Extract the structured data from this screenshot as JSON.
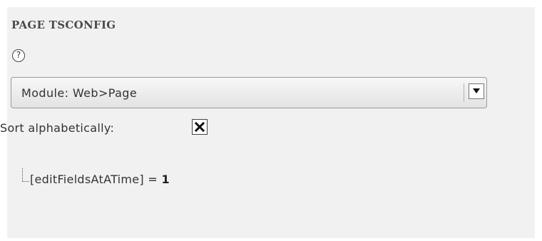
{
  "section": {
    "title": "PAGE TSCONFIG",
    "help_icon": "help-icon",
    "help_glyph": "?"
  },
  "module_select": {
    "value": "Module: Web>Page",
    "arrow_icon": "chevron-down-icon"
  },
  "sort": {
    "label": "Sort alphabetically:",
    "checked": true,
    "check_icon": "x-check-icon"
  },
  "tree": {
    "items": [
      {
        "key": "[editFieldsAtATime]",
        "operator": "=",
        "value": "1"
      }
    ]
  },
  "colors": {
    "panel_background": "#f1f1f1",
    "text": "#333333",
    "title": "#4a4a4a"
  }
}
